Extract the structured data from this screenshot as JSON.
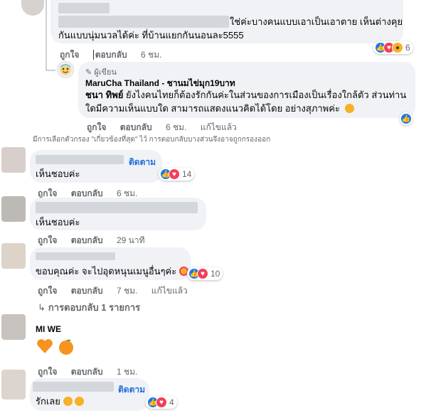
{
  "comments": {
    "c1": {
      "text_line1": "ใช่ค่ะบางคนแบบเอาเป็นเอาตาย เห็นต่างคุย",
      "text_line2": "กันแบบนุ่มนวลได้ค่ะ ที่บ้านแยกกันนอนละ5555",
      "like_label": "ถูกใจ",
      "reply_label": "ตอบกลับ",
      "time": "6 ชม.",
      "reaction_count": "6"
    },
    "author_reply": {
      "badge": "ผู้เขียน",
      "name": "MaruCha Thailand - ชานมไข่มุก19บาท",
      "mention": "ชนา ทิพย์",
      "text_line1": " ยังไงคนไทยก็ต้องรักกันค่ะในส่วนของการเมืองเป็นเรื่องใกล้ตัว ส่วนท่าน",
      "text_line2": "ใดมีความเห็นแบบใด สามารถแสดงแนวคิดได้โดย อย่างสุภาพค่ะ",
      "like_label": "ถูกใจ",
      "reply_label": "ตอบกลับ",
      "time": "6 ชม.",
      "edited": "แก้ไขแล้ว"
    },
    "filter_note": "มีการเลือกตัวกรอง \"เกี่ยวข้องที่สุด\" ไว้ การตอบกลับบางส่วนจึงอาจถูกกรองออก",
    "c2": {
      "follow": "ติดตาม",
      "text": "เห็นชอบค่ะ",
      "like_label": "ถูกใจ",
      "reply_label": "ตอบกลับ",
      "time": "6 ชม.",
      "reaction_count": "14"
    },
    "c3": {
      "text": "เห็นชอบค่ะ",
      "like_label": "ถูกใจ",
      "reply_label": "ตอบกลับ",
      "time": "29 นาที"
    },
    "c4": {
      "text": "ขอบคุณค่ะ จะไปอุดหนุนเมนูอื่นๆค่ะ",
      "like_label": "ถูกใจ",
      "reply_label": "ตอบกลับ",
      "time": "7 ชม.",
      "edited": "แก้ไขแล้ว",
      "reaction_count": "10",
      "replies_link": "การตอบกลับ 1 รายการ"
    },
    "c5": {
      "name": "MI WE",
      "like_label": "ถูกใจ",
      "reply_label": "ตอบกลับ",
      "time": "1 ชม."
    },
    "c6": {
      "follow": "ติดตาม",
      "text": "รักเลย",
      "reaction_count": "4"
    }
  },
  "colors": {
    "bubble": "#f0f2f5",
    "link_blue": "#216fdb",
    "meta_gray": "#65676b",
    "like_blue": "#1877f2",
    "love_red": "#f33e58"
  },
  "icons": [
    "like-icon",
    "love-icon",
    "wow-icon",
    "reply-arrow-icon",
    "heart-orange-emoji",
    "tangerine-emoji"
  ]
}
